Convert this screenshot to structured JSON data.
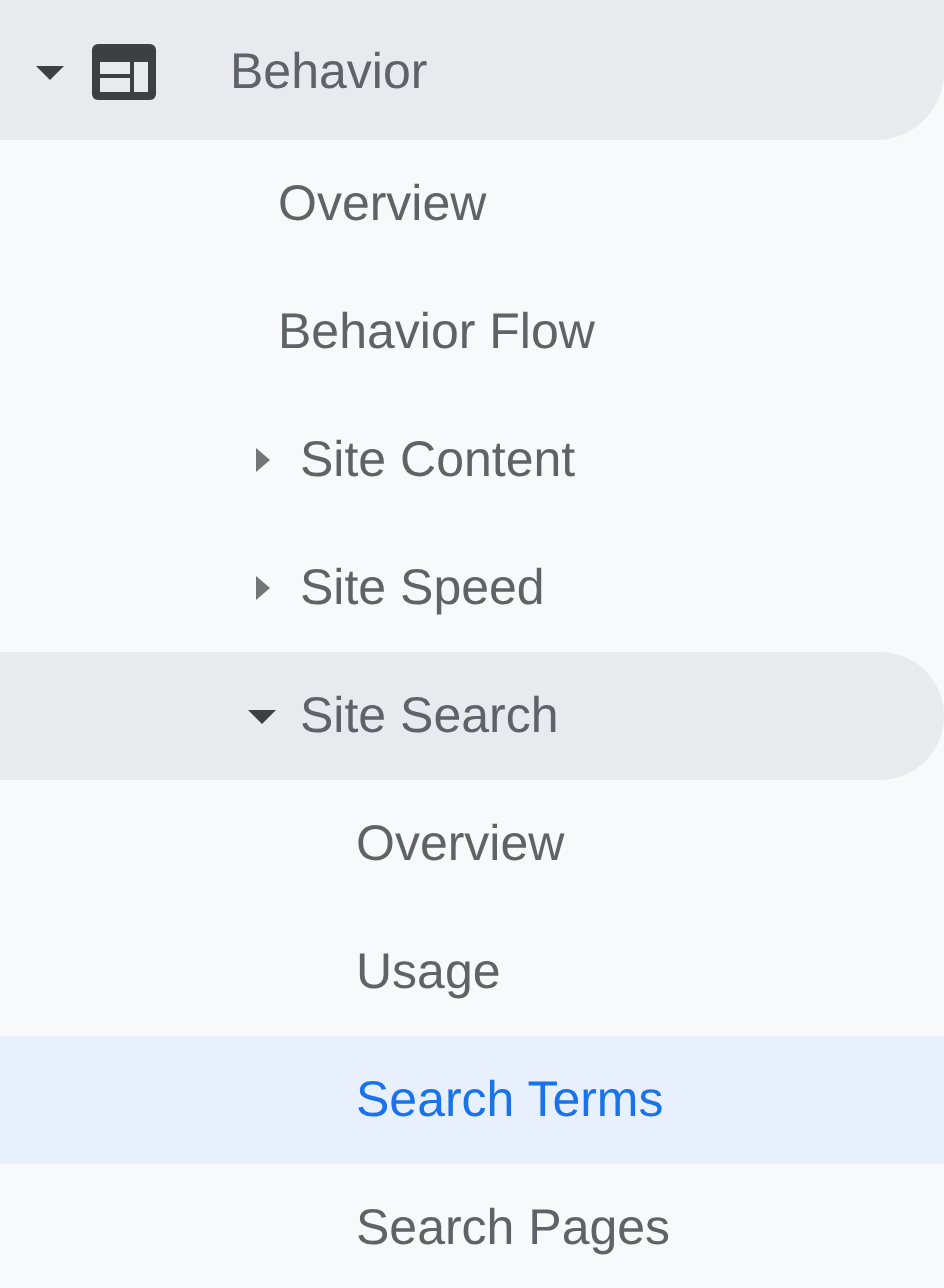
{
  "nav": {
    "items": [
      {
        "label": "Behavior",
        "expanded": true,
        "selected": false,
        "children": [
          {
            "label": "Overview",
            "selected": false
          },
          {
            "label": "Behavior Flow",
            "selected": false
          },
          {
            "label": "Site Content",
            "expanded": false,
            "selected": false
          },
          {
            "label": "Site Speed",
            "expanded": false,
            "selected": false
          },
          {
            "label": "Site Search",
            "expanded": true,
            "selected": false,
            "children": [
              {
                "label": "Overview",
                "selected": false
              },
              {
                "label": "Usage",
                "selected": false
              },
              {
                "label": "Search Terms",
                "selected": true
              },
              {
                "label": "Search Pages",
                "selected": false
              }
            ]
          }
        ]
      }
    ]
  }
}
